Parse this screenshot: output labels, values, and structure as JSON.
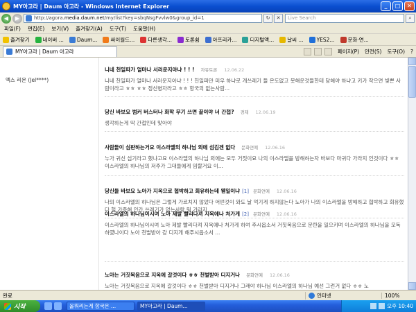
{
  "window": {
    "title": "MY아고라 | Daum 아고라 - Windows Internet Explorer",
    "minimize": "_",
    "maximize": "□",
    "close": "✕"
  },
  "address": {
    "url_prefix": "http://agora.",
    "url_host": "media.daum.net",
    "url_suffix": "/my/list?key=sbqNsgFvvlw0&group_id=1",
    "search_placeholder": "Live Search",
    "back": "◀",
    "forward": "▶",
    "refresh": "↻",
    "stop": "✕",
    "search_go": "⌕"
  },
  "menu": [
    "파일(F)",
    "편집(E)",
    "보기(V)",
    "즐겨찾기(A)",
    "도구(T)",
    "도움말(H)"
  ],
  "links": {
    "favorites_label": "즐겨찾기",
    "items": [
      {
        "label": "네이버 ...",
        "color": "#26b33f"
      },
      {
        "label": "Daum...",
        "color": "#3a7bd5"
      },
      {
        "label": "싸이월드...",
        "color": "#f07a1a"
      },
      {
        "label": "다른생각...",
        "color": "#d33"
      },
      {
        "label": "토론쉼",
        "color": "#8a2bd0"
      },
      {
        "label": "아프리카...",
        "color": "#3d6fd1"
      },
      {
        "label": "디지털액...",
        "color": "#2aa198"
      },
      {
        "label": "날씨 ...",
        "color": "#e6b800"
      },
      {
        "label": "YES2...",
        "color": "#1f6fd9"
      },
      {
        "label": "문화·연...",
        "color": "#c0392b"
      }
    ]
  },
  "tab": {
    "label": "MY아고라 | Daum 아고라"
  },
  "tools": {
    "page": "페이지(P)",
    "safety": "안전(S)",
    "tools": "도구(O)",
    "help": "?"
  },
  "profile": {
    "username": "엑스 리온 (Jel****)"
  },
  "posts": [
    {
      "title": "니네 천일파가 얼마나 서러운지아냐 ! ! !",
      "reply_count": "",
      "author": "자유토론",
      "date": "12.06.22",
      "body": "니네 천일파가 얼마나 서러운지아냐 ! ! ! 친일파만 미우 하냐로 개쓰레기 들 온도없고 못해운것들한테 당해야 하냐고 키가 작으면 빛쁜 사람이라고 ㅎㅎ ㅎㅎ 정신병자라고 ㅎㅎ 항국의 없는사람..."
    },
    {
      "title": "당신 바보요 범커 버스터나 화학 무기 쓰면 끝이야 너 간첩?",
      "reply_count": "",
      "author": "경제",
      "date": "12.06.19",
      "body": "생각하는게 딱 간첩인데 맞아야"
    },
    {
      "title": "사람들이 심판하는거요 이스라엘의 하나님 외에 섬김겐 없다",
      "reply_count": "",
      "author": "문화연예",
      "date": "12.06.16",
      "body": "누가 귀신 섬기라고 했냐고요 이스라엘의 하나님 외에는 모두 거짓이요 나의 이스라엘을 방해하는자 바보다 마귀다 가라지 인것이다 ㅎㅎ 이스라엘의 하나님의 저주가 그대들에게 임할거요 이..."
    },
    {
      "title": "당신들 바보요 노아가 지옥으로 협박하고 회유하는데 웬일이냐",
      "reply_count": "[1]",
      "author": "문화연예",
      "date": "12.06.16",
      "body": "나의 이스라엘의 하나님은 그렇게 가르치지 않았다 어떤것이 와도 날 억기게 하지않는다 노아가 나의 이스라엘을 방해하고 협박하고 회유했다 헐 가증해 인간 쓰레기가 없는사람 뭐 가라지 ..."
    },
    {
      "title": "이스라엘의 하나님이시여 노아 제발 빨리다져 지옥에나 처가게",
      "reply_count": "[2]",
      "author": "문화연예",
      "date": "12.06.16",
      "body": "이스라엘의 하나님이시여 노아 제발 빨리다져 지옥에나 처가게 하여 주시옵소서 거짓복음으로 문란을 일으키며 이스라엘의 하나님을 모독 하였나이다 노아 천벌받아 강 디지게 해주시옵소서 ..."
    },
    {
      "title": "노아는 거짓복음으로 지옥에 갈것이다 ㅎㅎ 천벌받아 디지거나",
      "reply_count": "",
      "author": "문화연예",
      "date": "12.06.16",
      "body": "노아는 거짓복음으로 지옥에 갈것이다 ㅎㅎ 천벌받아 디지거나 그래야 하나님 이스라엘의 하나님 예선 그런거 없다 ㅎㅎ 노"
    }
  ],
  "status": {
    "done": "완료",
    "zone": "인터넷",
    "zoom": "100%"
  },
  "taskbar": {
    "start": "시작",
    "tasks": [
      "올뭐리는게 항국은 ...",
      "MY아고라 | Daum..."
    ],
    "clock": "오후 10:40"
  }
}
